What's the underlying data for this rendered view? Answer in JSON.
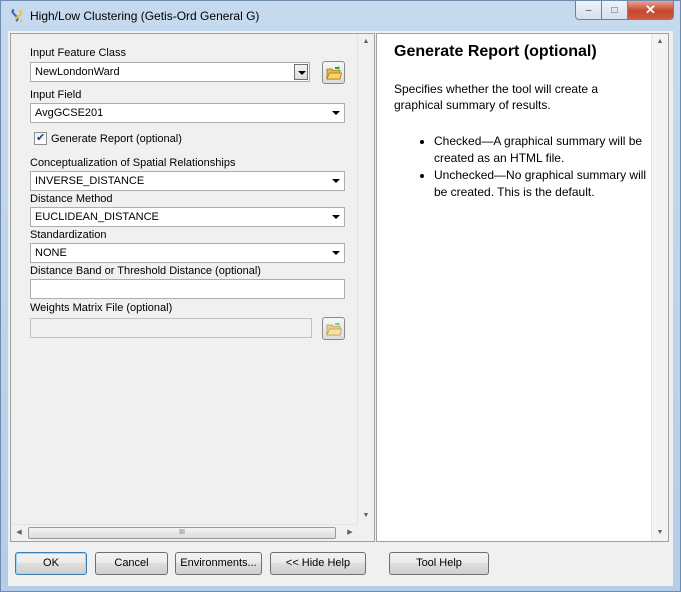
{
  "window": {
    "title": "High/Low Clustering (Getis-Ord General G)",
    "controls": {
      "minimize": "‒",
      "maximize": "□",
      "close": "✕"
    }
  },
  "form": {
    "input_feature_class": {
      "label": "Input Feature Class",
      "value": "NewLondonWard"
    },
    "input_field": {
      "label": "Input Field",
      "value": "AvgGCSE201"
    },
    "generate_report": {
      "label": "Generate Report (optional)",
      "checked": true
    },
    "conceptualization": {
      "label": "Conceptualization of Spatial Relationships",
      "value": "INVERSE_DISTANCE"
    },
    "distance_method": {
      "label": "Distance Method",
      "value": "EUCLIDEAN_DISTANCE"
    },
    "standardization": {
      "label": "Standardization",
      "value": "NONE"
    },
    "distance_band": {
      "label": "Distance Band or Threshold Distance (optional)",
      "value": ""
    },
    "weights_matrix": {
      "label": "Weights Matrix File (optional)",
      "value": ""
    }
  },
  "help": {
    "title": "Generate Report (optional)",
    "description": "Specifies whether the tool will create a graphical summary of results.",
    "items": [
      "Checked—A graphical summary will be created as an HTML file.",
      "Unchecked—No graphical summary will be created. This is the default."
    ]
  },
  "buttons": {
    "ok": "OK",
    "cancel": "Cancel",
    "environments": "Environments...",
    "hide_help": "<< Hide Help",
    "tool_help": "Tool Help"
  },
  "scrollbar_thumb_grip": "III",
  "colors": {
    "window_frame": "#b9d1ea",
    "close_button": "#c6472f",
    "pane_bg": "#f0f0f0"
  },
  "icons": [
    "python-script-icon",
    "folder-browse-icon"
  ]
}
